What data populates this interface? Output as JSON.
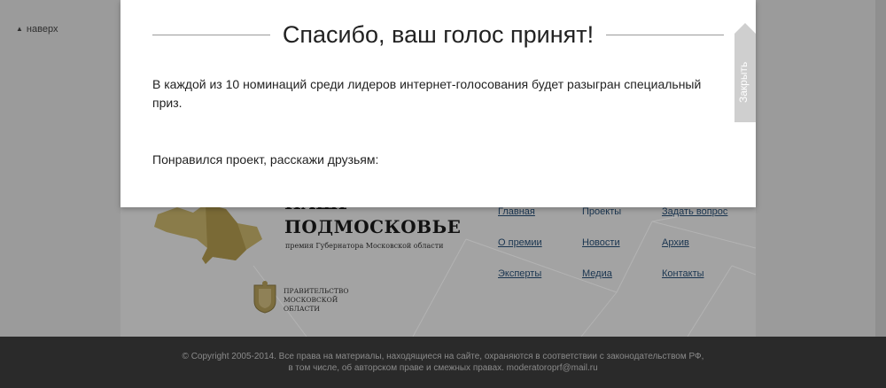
{
  "top_link": {
    "label": "наверх"
  },
  "logo": {
    "title": "ПОДМОСКОВЬЕ",
    "subtitle": "премия Губернатора Московской области"
  },
  "government": {
    "line1": "ПРАВИТЕЛЬСТВО",
    "line2": "МОСКОВСКОЙ",
    "line3": "ОБЛАСТИ"
  },
  "nav": {
    "col1": [
      "Главная",
      "О премии",
      "Эксперты"
    ],
    "col2": [
      "Проекты",
      "Новости",
      "Медиа"
    ],
    "col3": [
      "Задать вопрос",
      "Архив",
      "Контакты"
    ]
  },
  "footer": {
    "line1": "© Copyright 2005-2014. Все права на материалы, находящиеся на сайте, охраняются в соответствии с законодательством РФ,",
    "line2": "в том числе, об авторском праве и смежных правах. moderatoroprf@mail.ru"
  },
  "modal": {
    "title": "Спасибо, ваш голос принят!",
    "text": "В каждой из 10 номинаций среди лидеров интернет-голосования будет разыгран специальный приз.",
    "share": "Понравился проект, расскажи друзьям:",
    "close_label": "Закрыть"
  },
  "colors": {
    "overlay": "#9b9b9b",
    "footer_bg": "#2a2a2a",
    "modal_bg": "#ffffff",
    "close_tab": "#cfcfcf",
    "link": "#1a3550"
  }
}
